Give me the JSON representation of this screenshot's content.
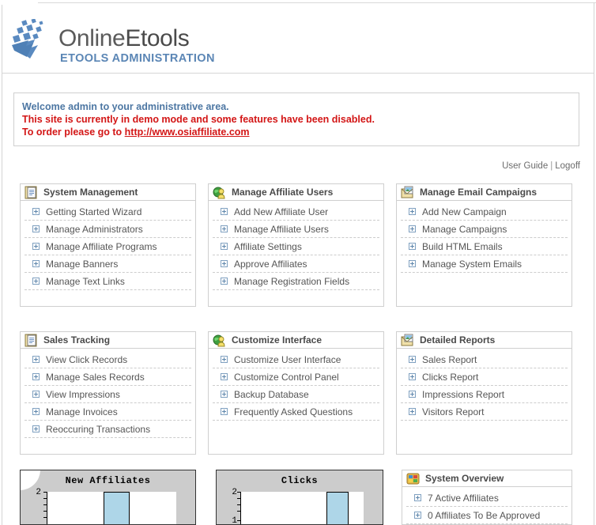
{
  "branding": {
    "logo_word_1": "Online",
    "logo_word_2": "Etools",
    "logo_subtitle": "ETOOLS ADMINISTRATION",
    "logo_icon": "pixel-arrow-logo-icon",
    "accent_blue": "#5b86b5",
    "logo_gray": "#5b5b5b"
  },
  "welcome": {
    "line_1": "Welcome admin to your administrative area.",
    "line_2": "This site is currently in demo mode and some features have been disabled.",
    "line_3_prefix": "To order please go to ",
    "line_3_link": "http://www.osiaffiliate.com",
    "info_color": "#4d77a3",
    "warning_color": "#d31616"
  },
  "top_links": {
    "user_guide": "User Guide",
    "separator": "|",
    "logoff": "Logoff"
  },
  "panels": [
    {
      "title": "System Management",
      "icon": "document-list-icon",
      "items": [
        "Getting Started Wizard",
        "Manage Administrators",
        "Manage Affiliate Programs",
        "Manage Banners",
        "Manage Text Links"
      ]
    },
    {
      "title": "Manage Affiliate Users",
      "icon": "globe-user-icon",
      "items": [
        "Add New Affiliate User",
        "Manage Affiliate Users",
        "Affiliate Settings",
        "Approve Affiliates",
        "Manage Registration Fields"
      ]
    },
    {
      "title": "Manage Email Campaigns",
      "icon": "envelope-image-icon",
      "items": [
        "Add New Campaign",
        "Manage Campaigns",
        "Build HTML Emails",
        "Manage System Emails"
      ]
    },
    {
      "title": "Sales Tracking",
      "icon": "document-list-icon",
      "items": [
        "View Click Records",
        "Manage Sales Records",
        "View Impressions",
        "Manage Invoices",
        "Reoccuring Transactions"
      ]
    },
    {
      "title": "Customize Interface",
      "icon": "globe-user-icon",
      "items": [
        "Customize User Interface",
        "Customize Control Panel",
        "Backup Database",
        "Frequently Asked Questions"
      ]
    },
    {
      "title": "Detailed Reports",
      "icon": "envelope-image-icon",
      "items": [
        "Sales Report",
        "Clicks Report",
        "Impressions Report",
        "Visitors Report"
      ]
    }
  ],
  "system_overview": {
    "title": "System Overview",
    "icon": "color-grid-icon",
    "items": [
      "7 Active Affiliates",
      "0 Affiliates To Be Approved"
    ]
  },
  "chart_data": [
    {
      "type": "bar",
      "title": "New Affiliates",
      "categories": [
        "",
        "",
        ""
      ],
      "values": [
        0,
        2,
        0
      ],
      "ylim": [
        0,
        2
      ],
      "ytick_labels": [
        "2"
      ],
      "xlabel": "",
      "ylabel": "",
      "bar_color": "#aed6e8",
      "background": "#cccccc",
      "plot_background": "#ffffff",
      "grid": false,
      "legend": false
    },
    {
      "type": "bar",
      "title": "Clicks",
      "categories": [
        "",
        "",
        ""
      ],
      "values": [
        0,
        0,
        2
      ],
      "ylim": [
        0,
        2
      ],
      "ytick_labels": [
        "2",
        "1"
      ],
      "xlabel": "",
      "ylabel": "",
      "bar_color": "#aed6e8",
      "background": "#cccccc",
      "plot_background": "#ffffff",
      "grid": false,
      "legend": false
    }
  ]
}
